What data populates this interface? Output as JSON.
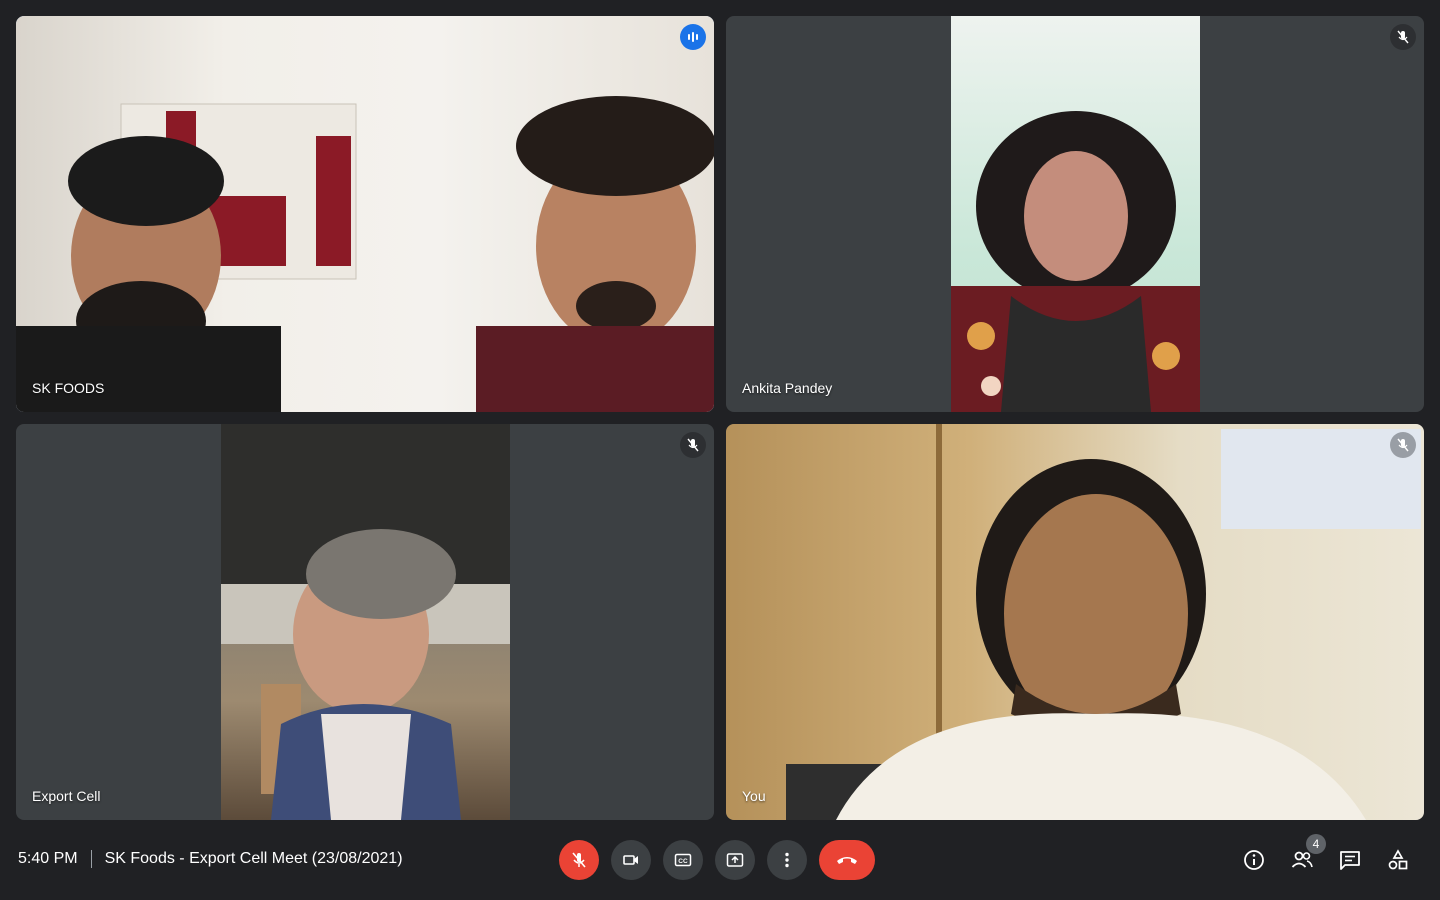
{
  "participants": [
    {
      "name": "SK FOODS",
      "speaking": true
    },
    {
      "name": "Ankita Pandey",
      "muted": true
    },
    {
      "name": "Export Cell",
      "muted": true
    },
    {
      "name": "You",
      "muted": true
    }
  ],
  "meeting": {
    "time": "5:40 PM",
    "title": "SK Foods - Export Cell Meet (23/08/2021)"
  },
  "controls": {
    "mic": "mic-off-icon",
    "camera": "videocam-icon",
    "captions": "closed-caption-icon",
    "present": "present-screen-icon",
    "more": "more-vert-icon",
    "leave": "call-end-icon"
  },
  "side_panel": {
    "people_count": "4"
  },
  "colors": {
    "background": "#202124",
    "tile": "#3c4043",
    "active_outline": "#8ab4f8",
    "speaking_badge": "#1a73e8",
    "danger": "#ea4335"
  }
}
